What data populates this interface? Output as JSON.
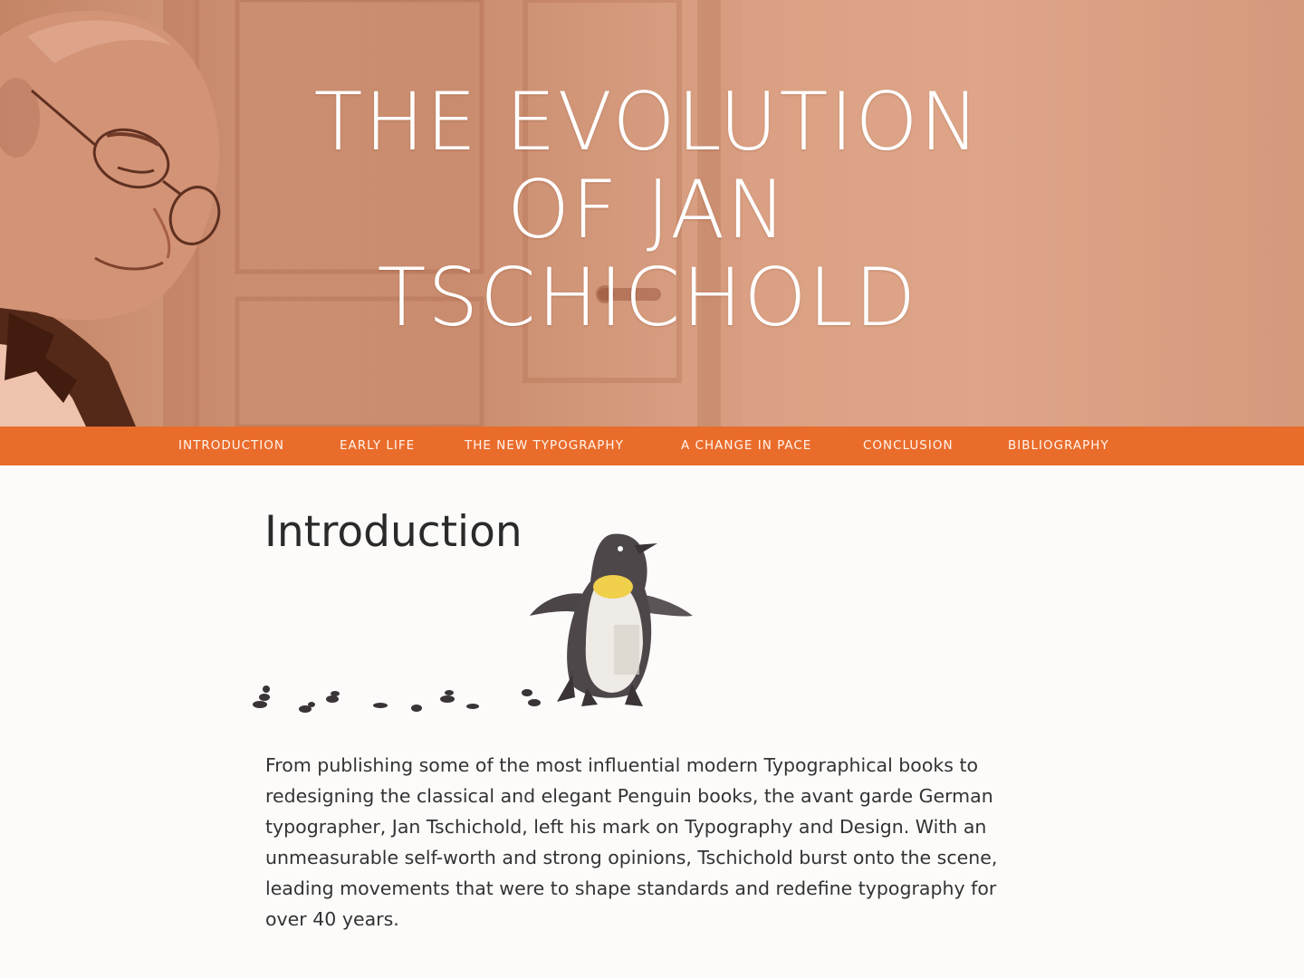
{
  "hero": {
    "title": "THE EVOLUTION OF JAN TSCHICHOLD"
  },
  "nav": {
    "items": [
      {
        "label": "INTRODUCTION"
      },
      {
        "label": "EARLY LIFE"
      },
      {
        "label": "THE NEW TYPOGRAPHY"
      },
      {
        "label": "A CHANGE IN PACE"
      },
      {
        "label": "CONCLUSION"
      },
      {
        "label": "BIBLIOGRAPHY"
      }
    ]
  },
  "content": {
    "heading": "Introduction",
    "paragraph": "From publishing some of the most influential modern Typographical books to redesigning the classical and elegant Penguin books, the avant garde German typographer, Jan Tschichold, left his mark on Typography and Design. With an unmeasurable self-worth and strong opinions, Tschichold burst onto the scene, leading movements that were to shape standards and redefine typography for over 40 years."
  },
  "colors": {
    "nav_background": "#ea6c2b",
    "hero_tint": "#d2987b",
    "text": "#333333"
  }
}
